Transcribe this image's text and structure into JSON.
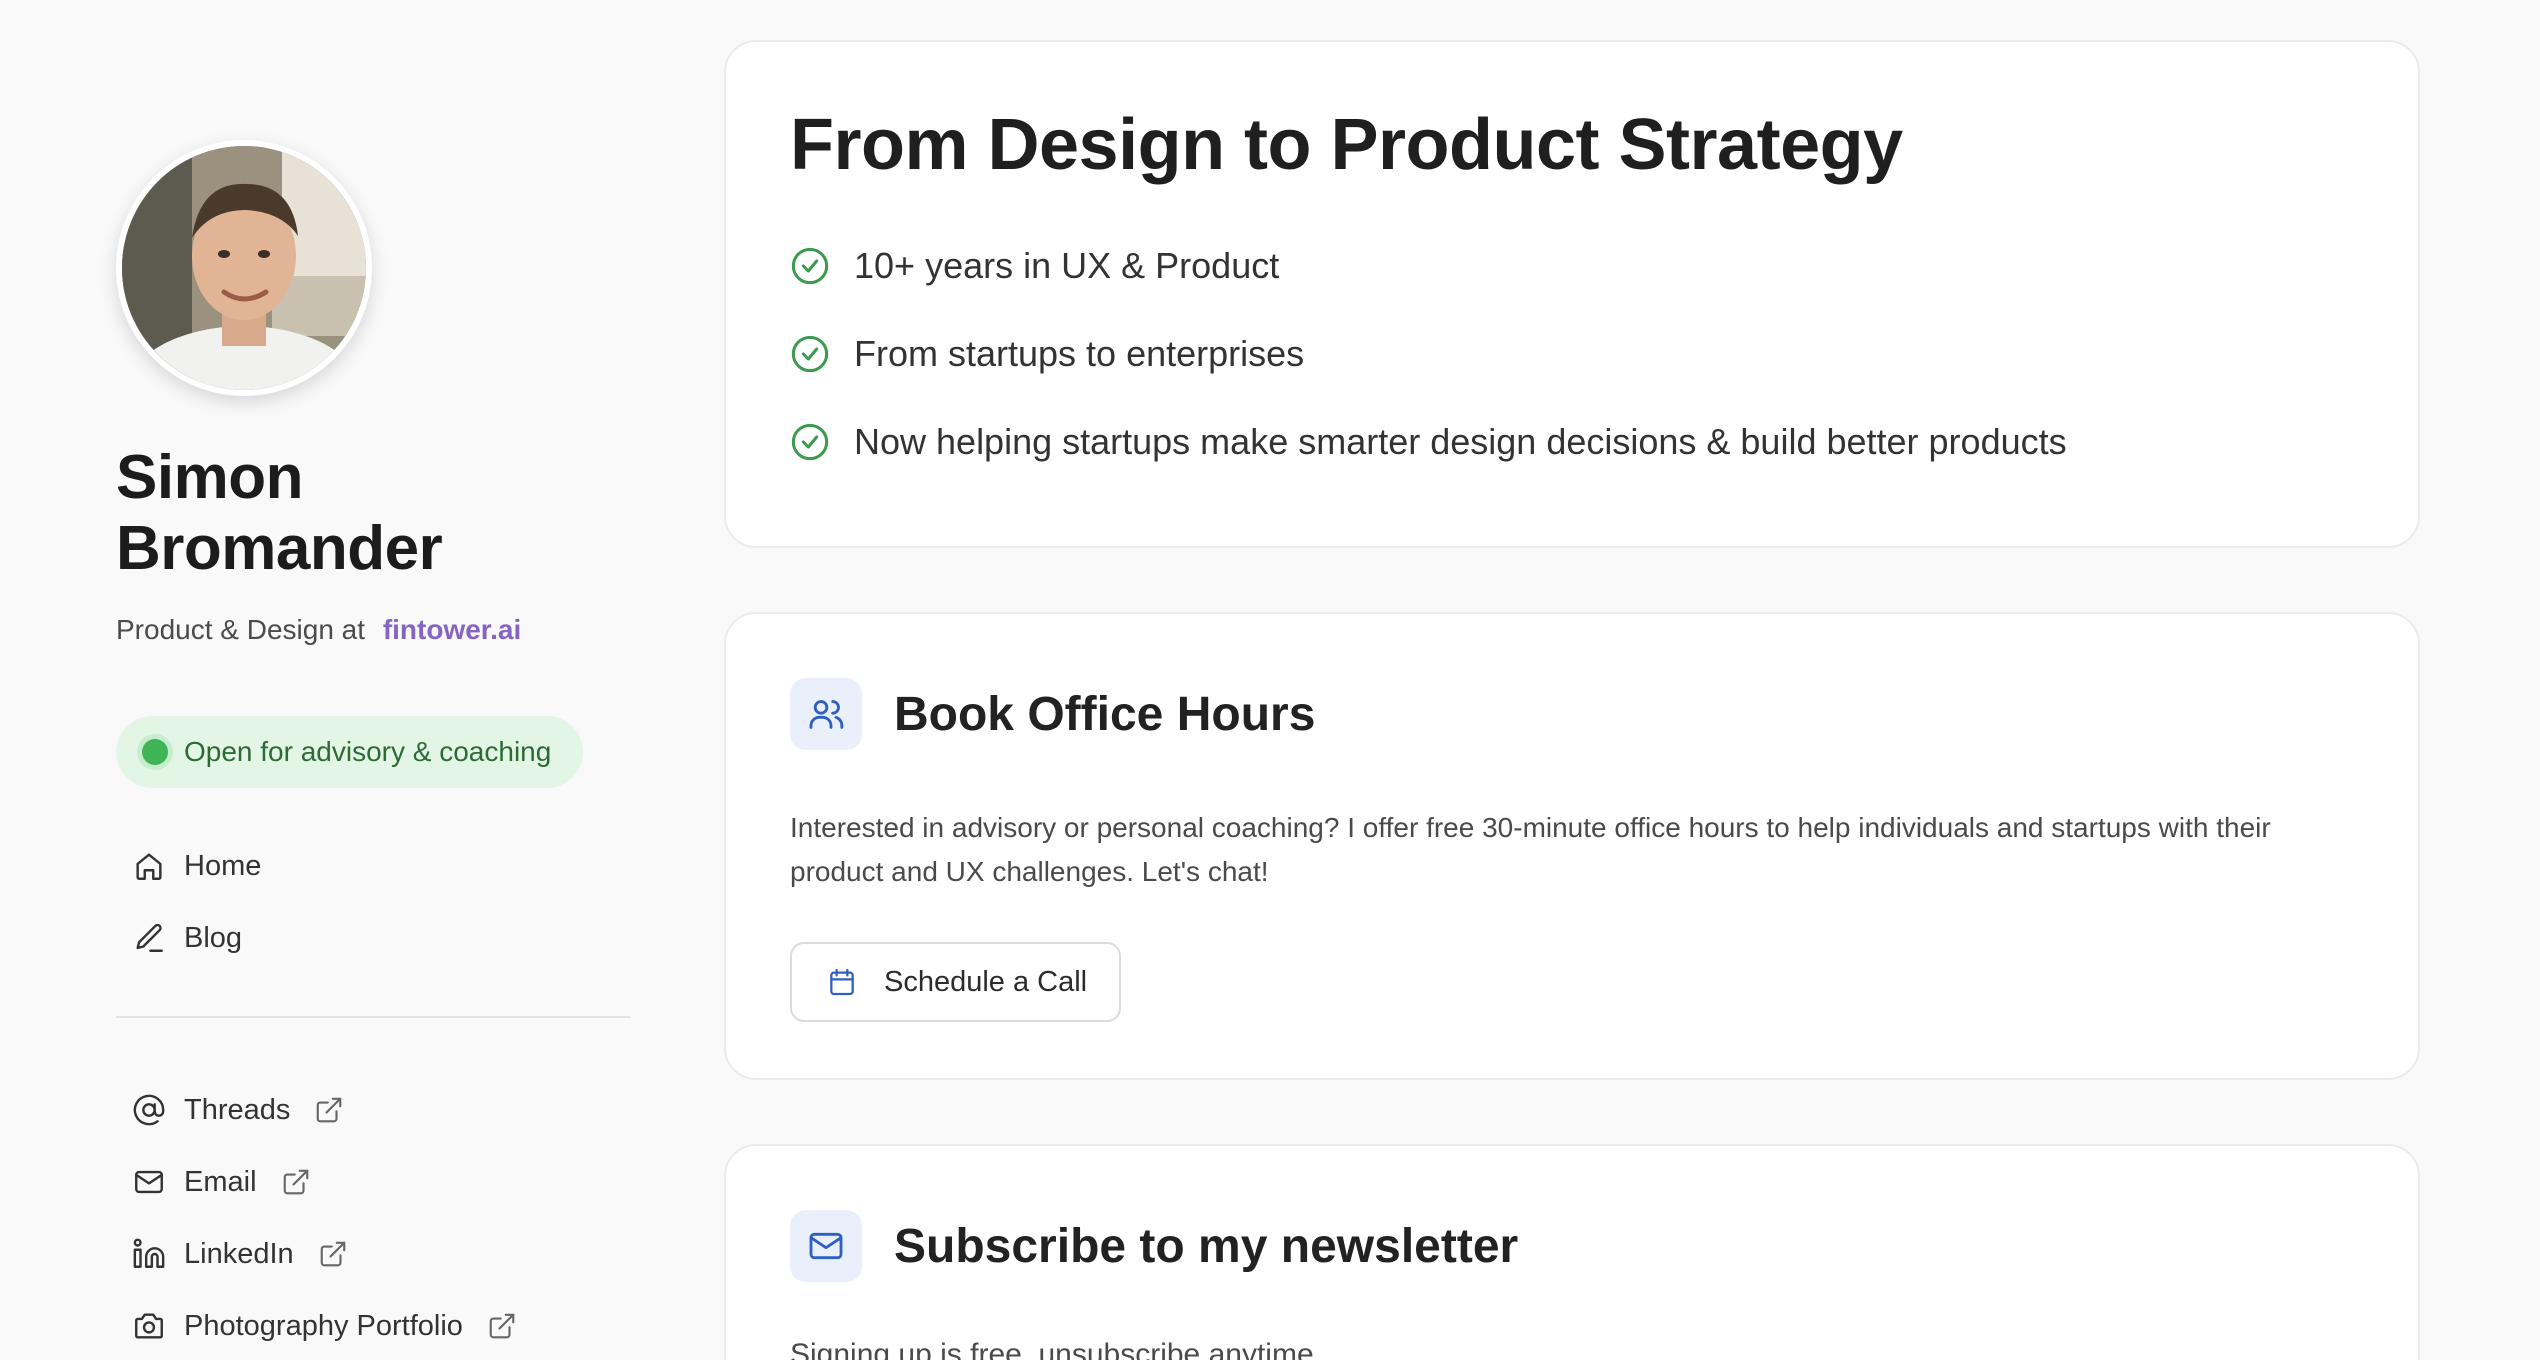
{
  "profile": {
    "name": "Simon Bromander",
    "role_prefix": "Product & Design at",
    "company": "fintower.ai",
    "status": "Open for advisory & coaching"
  },
  "nav": {
    "primary": [
      {
        "label": "Home",
        "icon": "home-icon"
      },
      {
        "label": "Blog",
        "icon": "pencil-icon"
      }
    ],
    "external": [
      {
        "label": "Threads",
        "icon": "at-icon"
      },
      {
        "label": "Email",
        "icon": "mail-icon"
      },
      {
        "label": "LinkedIn",
        "icon": "linkedin-icon"
      },
      {
        "label": "Photography Portfolio",
        "icon": "camera-icon"
      }
    ]
  },
  "hero": {
    "title": "From Design to Product Strategy",
    "points": [
      "10+ years in UX & Product",
      "From startups to enterprises",
      "Now helping startups make smarter design decisions & build better products"
    ]
  },
  "office_hours": {
    "title": "Book Office Hours",
    "text": "Interested in advisory or personal coaching? I offer free 30-minute office hours to help individuals and startups with their product and UX challenges. Let's chat!",
    "button": "Schedule a Call"
  },
  "newsletter": {
    "title": "Subscribe to my newsletter",
    "text": "Signing up is free, unsubscribe anytime."
  },
  "colors": {
    "accent_purple": "#8565c4",
    "status_green": "#3fb457",
    "icon_blue": "#2f5fc4",
    "check_green": "#3a9a4e"
  }
}
